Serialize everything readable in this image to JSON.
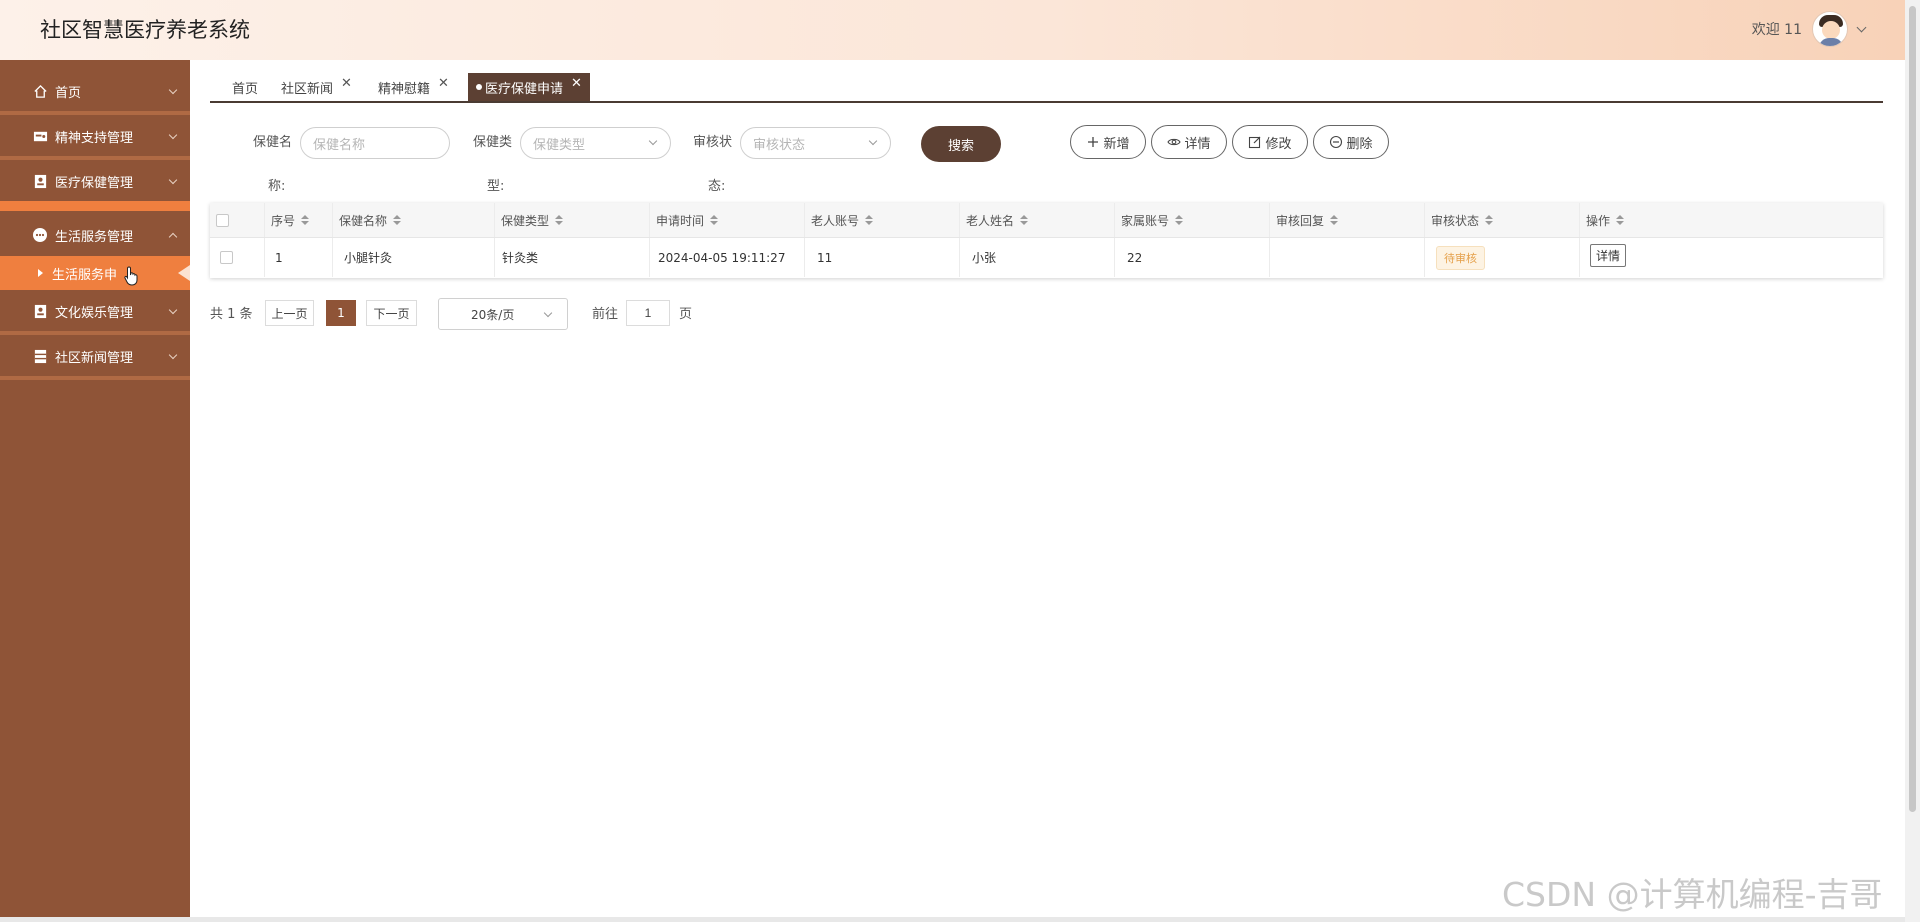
{
  "header": {
    "title": "社区智慧医疗养老系统",
    "welcome": "欢迎 11"
  },
  "sidebar": {
    "items": [
      {
        "label": "首页",
        "icon": "home-icon"
      },
      {
        "label": "精神支持管理",
        "icon": "card-icon"
      },
      {
        "label": "医疗保健管理",
        "icon": "badge-icon"
      },
      {
        "label": "生活服务管理",
        "icon": "chat-icon",
        "expanded": true
      },
      {
        "label": "文化娱乐管理",
        "icon": "badge-icon"
      },
      {
        "label": "社区新闻管理",
        "icon": "list-icon"
      }
    ],
    "submenu": {
      "label": "生活服务申"
    }
  },
  "tabs": [
    {
      "label": "首页",
      "closable": false
    },
    {
      "label": "社区新闻",
      "closable": true
    },
    {
      "label": "精神慰籍",
      "closable": true
    },
    {
      "label": "医疗保健申请",
      "closable": true,
      "active": true
    }
  ],
  "search": {
    "name_label": "保健名",
    "name_label_wrap": "称:",
    "name_placeholder": "保健名称",
    "type_label": "保健类",
    "type_label_wrap": "型:",
    "type_placeholder": "保健类型",
    "status_label": "审核状",
    "status_label_wrap": "态:",
    "status_placeholder": "审核状态",
    "search_button": "搜索"
  },
  "actions": {
    "add": "新增",
    "detail": "详情",
    "edit": "修改",
    "delete": "删除"
  },
  "table": {
    "columns": [
      "序号",
      "保健名称",
      "保健类型",
      "申请时间",
      "老人账号",
      "老人姓名",
      "家属账号",
      "审核回复",
      "审核状态",
      "操作"
    ],
    "rows": [
      {
        "index": "1",
        "name": "小腿针灸",
        "type": "针灸类",
        "time": "2024-04-05 19:11:27",
        "elder_account": "11",
        "elder_name": "小张",
        "family_account": "22",
        "reply": "",
        "status": "待审核",
        "action": "详情"
      }
    ]
  },
  "pagination": {
    "total": "共 1 条",
    "prev": "上一页",
    "current": "1",
    "next": "下一页",
    "page_size": "20条/页",
    "goto_label": "前往",
    "goto_value": "1",
    "page_suffix": "页"
  },
  "watermark": "CSDN @计算机编程-吉哥",
  "colors": {
    "sidebar_bg": "#8f5437",
    "sidebar_active": "#ef7f3f",
    "primary_dark": "#5c4033",
    "status_pending": "#e5a04a"
  }
}
